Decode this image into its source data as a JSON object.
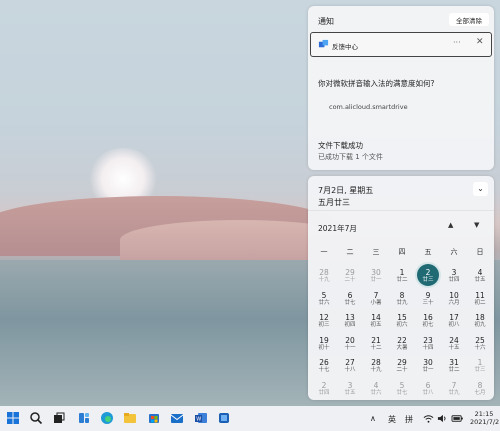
{
  "notifications": {
    "header": "通知",
    "clear_all": "全部清除",
    "app_name": "反馈中心",
    "more_dots": "···",
    "close": "✕",
    "survey_text": "你对微软拼音输入法的满意度如何?",
    "source": "com.alicloud.smartdrive",
    "download_title": "文件下载成功",
    "download_sub": "已成功下载 1 个文件"
  },
  "calendar": {
    "date_line": "7月2日, 星期五",
    "lunar_line": "五月廿三",
    "collapse": "⌄",
    "month_title": "2021年7月",
    "nav_up": "▲",
    "nav_down": "▼",
    "weekdays": [
      "一",
      "二",
      "三",
      "四",
      "五",
      "六",
      "日"
    ],
    "days": [
      {
        "n": "28",
        "l": "十九",
        "muted": true
      },
      {
        "n": "29",
        "l": "二十",
        "muted": true
      },
      {
        "n": "30",
        "l": "廿一",
        "muted": true
      },
      {
        "n": "1",
        "l": "廿二"
      },
      {
        "n": "2",
        "l": "廿三",
        "today": true
      },
      {
        "n": "3",
        "l": "廿四"
      },
      {
        "n": "4",
        "l": "廿五"
      },
      {
        "n": "5",
        "l": "廿六"
      },
      {
        "n": "6",
        "l": "廿七"
      },
      {
        "n": "7",
        "l": "小暑"
      },
      {
        "n": "8",
        "l": "廿九"
      },
      {
        "n": "9",
        "l": "三十"
      },
      {
        "n": "10",
        "l": "六月"
      },
      {
        "n": "11",
        "l": "初二"
      },
      {
        "n": "12",
        "l": "初三"
      },
      {
        "n": "13",
        "l": "初四"
      },
      {
        "n": "14",
        "l": "初五"
      },
      {
        "n": "15",
        "l": "初六"
      },
      {
        "n": "16",
        "l": "初七"
      },
      {
        "n": "17",
        "l": "初八"
      },
      {
        "n": "18",
        "l": "初九"
      },
      {
        "n": "19",
        "l": "初十"
      },
      {
        "n": "20",
        "l": "十一"
      },
      {
        "n": "21",
        "l": "十二"
      },
      {
        "n": "22",
        "l": "大暑"
      },
      {
        "n": "23",
        "l": "十四"
      },
      {
        "n": "24",
        "l": "十五"
      },
      {
        "n": "25",
        "l": "十六"
      },
      {
        "n": "26",
        "l": "十七"
      },
      {
        "n": "27",
        "l": "十八"
      },
      {
        "n": "28",
        "l": "十九"
      },
      {
        "n": "29",
        "l": "二十"
      },
      {
        "n": "30",
        "l": "廿一"
      },
      {
        "n": "31",
        "l": "廿二"
      },
      {
        "n": "1",
        "l": "廿三",
        "muted": true
      },
      {
        "n": "2",
        "l": "廿四",
        "muted": true
      },
      {
        "n": "3",
        "l": "廿五",
        "muted": true
      },
      {
        "n": "4",
        "l": "廿六",
        "muted": true
      },
      {
        "n": "5",
        "l": "廿七",
        "muted": true
      },
      {
        "n": "6",
        "l": "廿八",
        "muted": true
      },
      {
        "n": "7",
        "l": "廿九",
        "muted": true
      },
      {
        "n": "8",
        "l": "七月",
        "muted": true
      }
    ]
  },
  "taskbar": {
    "apps": [
      "windows-start-icon",
      "search-icon",
      "task-view-icon",
      "widgets-icon",
      "edge-browser-icon",
      "file-explorer-icon",
      "store-icon",
      "mail-icon",
      "word-icon",
      "app-icon"
    ],
    "chevron": "∧",
    "ime_lang": "英",
    "ime_mode": "拼",
    "time": "21:15",
    "date": "2021/7/2"
  },
  "colors": {
    "accent": "#1f6a73",
    "panel": "#f3f4f6",
    "taskbar": "#eef0f3"
  }
}
